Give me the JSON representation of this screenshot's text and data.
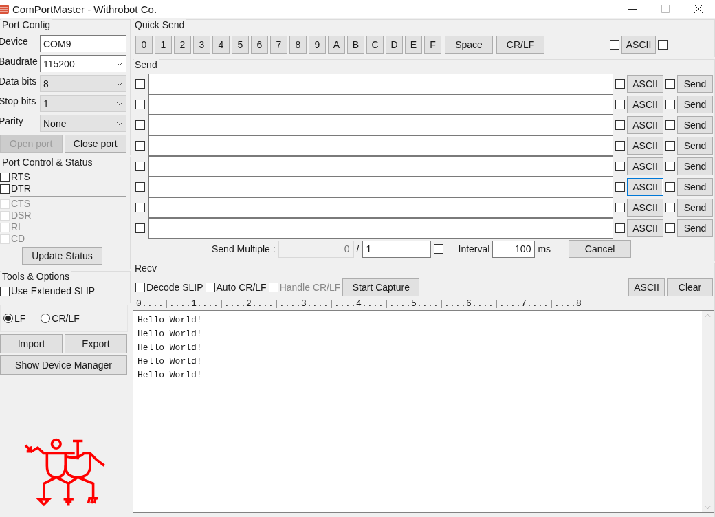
{
  "window": {
    "title": "ComPortMaster - Withrobot Co."
  },
  "port_config": {
    "title": "Port Config",
    "fields": [
      {
        "label": "Device",
        "kind": "text",
        "value": "COM9",
        "disabled": false
      },
      {
        "label": "Baudrate",
        "kind": "select",
        "value": "115200",
        "disabled": false
      },
      {
        "label": "Data bits",
        "kind": "select",
        "value": "8",
        "disabled": true
      },
      {
        "label": "Stop bits",
        "kind": "select",
        "value": "1",
        "disabled": true
      },
      {
        "label": "Parity",
        "kind": "select",
        "value": "None",
        "disabled": true
      }
    ],
    "buttons": [
      {
        "label": "Open port",
        "disabled": true
      },
      {
        "label": "Close port",
        "disabled": false
      }
    ]
  },
  "port_control": {
    "title": "Port Control & Status",
    "outputs": [
      {
        "label": "RTS",
        "checked": false,
        "disabled": false
      },
      {
        "label": "DTR",
        "checked": false,
        "disabled": false
      }
    ],
    "inputs": [
      {
        "label": "CTS",
        "checked": false,
        "disabled": true
      },
      {
        "label": "DSR",
        "checked": false,
        "disabled": true
      },
      {
        "label": "RI",
        "checked": false,
        "disabled": true
      },
      {
        "label": "CD",
        "checked": false,
        "disabled": true
      }
    ],
    "button": "Update Status"
  },
  "tools": {
    "title": "Tools & Options",
    "options": [
      {
        "label": "Use Extended SLIP",
        "checked": false,
        "disabled": false
      }
    ],
    "line_endings": [
      {
        "label": "LF",
        "selected": true
      },
      {
        "label": "CR/LF",
        "selected": false
      }
    ],
    "buttons": [
      "Import",
      "Export"
    ],
    "wide_button": "Show Device Manager"
  },
  "quick_send": {
    "title": "Quick Send",
    "keys": [
      "0",
      "1",
      "2",
      "3",
      "4",
      "5",
      "6",
      "7",
      "8",
      "9",
      "A",
      "B",
      "C",
      "D",
      "E",
      "F"
    ],
    "wide_keys": [
      "Space",
      "CR/LF"
    ],
    "ascii_before_checked": false,
    "ascii": "ASCII",
    "ascii_after_checked": false
  },
  "send": {
    "title": "Send",
    "rows": [
      {
        "checked": false,
        "value": "",
        "ascii": "ASCII",
        "ascii_checked": false,
        "ascii_focused": false,
        "send_checked": false,
        "button": "Send"
      },
      {
        "checked": false,
        "value": "",
        "ascii": "ASCII",
        "ascii_checked": false,
        "ascii_focused": false,
        "send_checked": false,
        "button": "Send"
      },
      {
        "checked": false,
        "value": "",
        "ascii": "ASCII",
        "ascii_checked": false,
        "ascii_focused": false,
        "send_checked": false,
        "button": "Send"
      },
      {
        "checked": false,
        "value": "",
        "ascii": "ASCII",
        "ascii_checked": false,
        "ascii_focused": false,
        "send_checked": false,
        "button": "Send"
      },
      {
        "checked": false,
        "value": "",
        "ascii": "ASCII",
        "ascii_checked": false,
        "ascii_focused": false,
        "send_checked": false,
        "button": "Send"
      },
      {
        "checked": false,
        "value": "",
        "ascii": "ASCII",
        "ascii_checked": false,
        "ascii_focused": true,
        "send_checked": false,
        "button": "Send"
      },
      {
        "checked": false,
        "value": "",
        "ascii": "ASCII",
        "ascii_checked": false,
        "ascii_focused": false,
        "send_checked": false,
        "button": "Send"
      },
      {
        "checked": false,
        "value": "",
        "ascii": "ASCII",
        "ascii_checked": false,
        "ascii_focused": false,
        "send_checked": false,
        "button": "Send"
      }
    ],
    "multiple": {
      "label": "Send Multiple :",
      "count": "0",
      "separator": "/",
      "total": "1",
      "repeat_checked": false,
      "interval_label": "Interval",
      "interval": "100",
      "unit": "ms",
      "cancel": "Cancel"
    }
  },
  "recv": {
    "title": "Recv",
    "options": [
      {
        "label": "Decode SLIP",
        "checked": false,
        "disabled": false
      },
      {
        "label": "Auto CR/LF",
        "checked": false,
        "disabled": false
      },
      {
        "label": "Handle CR/LF",
        "checked": false,
        "disabled": true
      }
    ],
    "capture": "Start Capture",
    "ascii": "ASCII",
    "clear": "Clear",
    "ruler": "0....|....1....|....2....|....3....|....4....|....5....|....6....|....7....|....8",
    "lines": [
      "Hello World!",
      "Hello World!",
      "Hello World!",
      "Hello World!",
      "Hello World!"
    ]
  }
}
